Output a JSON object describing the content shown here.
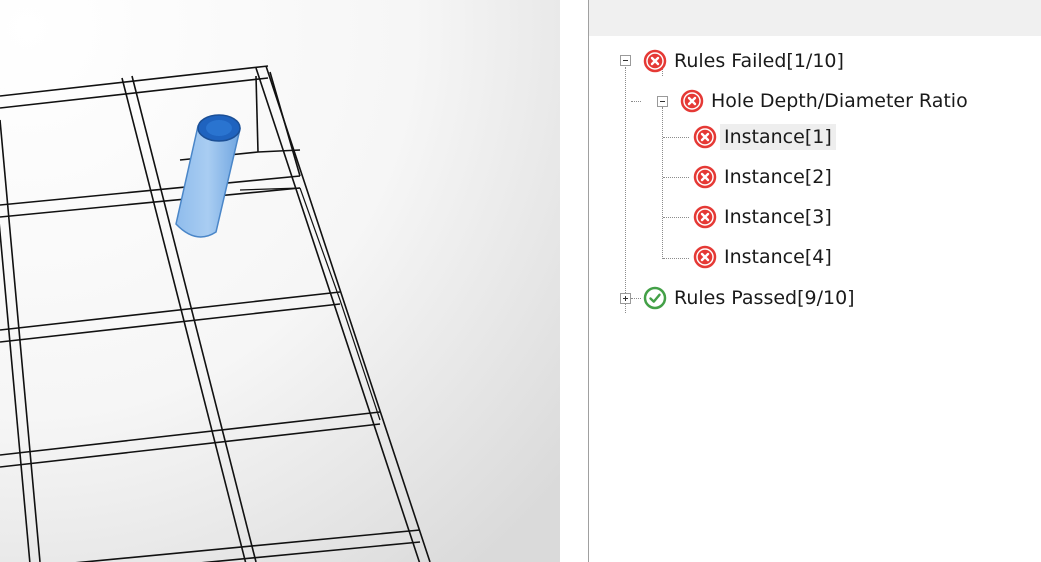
{
  "viewport": {
    "model": "wireframe-grid-plate",
    "feature": "cylindrical-hole",
    "feature_color": "#3a7fd0"
  },
  "tree": {
    "rules_failed": {
      "label": "Rules Failed[1/10]",
      "icon": "error-icon",
      "expanded": true,
      "children": [
        {
          "label": "Hole Depth/Diameter Ratio",
          "icon": "error-icon",
          "expanded": true,
          "instances": [
            {
              "label": "Instance[1]",
              "icon": "error-icon",
              "selected": true
            },
            {
              "label": "Instance[2]",
              "icon": "error-icon",
              "selected": false
            },
            {
              "label": "Instance[3]",
              "icon": "error-icon",
              "selected": false
            },
            {
              "label": "Instance[4]",
              "icon": "error-icon",
              "selected": false
            }
          ]
        }
      ]
    },
    "rules_passed": {
      "label": "Rules Passed[9/10]",
      "icon": "check-icon",
      "expanded": false
    }
  },
  "colors": {
    "error_red": "#e53935",
    "success_green": "#43a047",
    "selection": "#eeeeee"
  }
}
